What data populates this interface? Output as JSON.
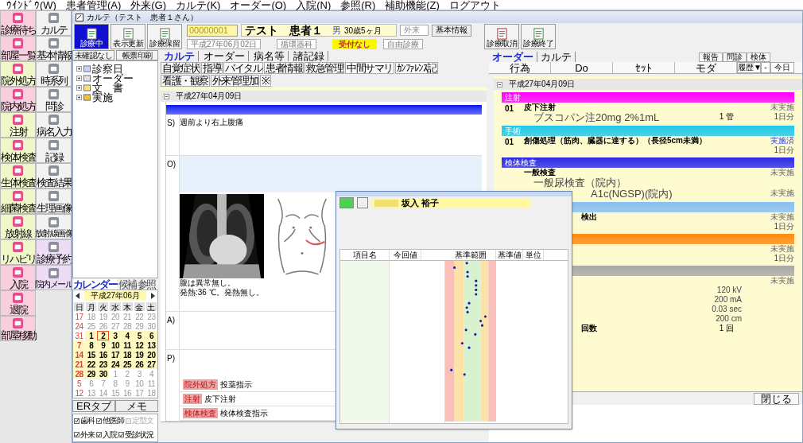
{
  "menu": [
    "ｳｲﾝﾄﾞｳ(W)",
    "患者管理(A)",
    "外来(G)",
    "カルテ(K)",
    "オーダー(O)",
    "入院(N)",
    "参照(R)",
    "補助機能(Z)",
    "ログアウト"
  ],
  "launcher": {
    "left": [
      {
        "label": "診療待ち",
        "color": "#f9cfe0"
      },
      {
        "label": "部屋一覧",
        "color": "#f9cfe0"
      },
      {
        "label": "院外処方",
        "color": "#eef7c8"
      },
      {
        "label": "院内処方",
        "color": "#f9cfe0"
      },
      {
        "label": "注射",
        "color": "#eef7c8"
      },
      {
        "label": "検体検査",
        "color": "#eef7c8"
      },
      {
        "label": "生体検査",
        "color": "#eef7c8"
      },
      {
        "label": "細菌検査",
        "color": "#eef7c8"
      },
      {
        "label": "放射線",
        "color": "#eef7c8"
      },
      {
        "label": "リハビリ",
        "color": "#eef7c8"
      },
      {
        "label": "入院",
        "color": "#f9cfe0"
      },
      {
        "label": "退院",
        "color": "#f9cfe0"
      },
      {
        "label": "部屋移動",
        "color": "#f9cfe0"
      }
    ],
    "right": [
      {
        "label": "カルテ",
        "color": "#f2f2f2"
      },
      {
        "label": "基本情報",
        "color": "#f2f2f2"
      },
      {
        "label": "時系列",
        "color": "#f2f2f2"
      },
      {
        "label": "問診",
        "color": "#f2f2f2"
      },
      {
        "label": "病名入力",
        "color": "#f2f2f2"
      },
      {
        "label": "記録",
        "color": "#f2f2f2"
      },
      {
        "label": "検査結果",
        "color": "#f2f2f2"
      },
      {
        "label": "生理画像",
        "color": "#f2f2f2"
      },
      {
        "label": "放射線画像",
        "color": "#f2f2f2"
      },
      {
        "label": "診療予約",
        "color": "#ecdcf5"
      },
      {
        "label": "院内メール",
        "color": "#ecdcf5"
      }
    ]
  },
  "window": {
    "title": "カルテ（テスト　患者１さん）"
  },
  "toolbar": {
    "left_buttons": [
      {
        "label": "診療中",
        "selected": true
      },
      {
        "label": "表示更新",
        "selected": false
      },
      {
        "label": "診療保留",
        "selected": false
      }
    ],
    "patient_id": "00000001",
    "patient_name": "テスト　患者１",
    "sex": "男",
    "age": "30歳5ヶ月",
    "visit_type": "外来",
    "info_button": "基本情報",
    "date": "平成27年06月02日",
    "department": "循環器科",
    "reception": "受付なし",
    "insurance": "自由診療",
    "right_buttons": [
      "診療取消",
      "診療終了"
    ]
  },
  "left_pane": {
    "buttons": [
      "未確認なし",
      "帳票印刷"
    ],
    "tree": [
      "診察日",
      "オーダー",
      "文　書",
      "実施"
    ],
    "tabs": [
      {
        "label": "カレンダー",
        "selected": true
      },
      {
        "label": "候補",
        "selected": false
      },
      {
        "label": "参照",
        "selected": false
      }
    ],
    "calendar": {
      "month": "平成27年06月",
      "weekdays": [
        "日",
        "月",
        "火",
        "水",
        "木",
        "金",
        "土"
      ],
      "weeks": [
        [
          {
            "day": "17",
            "in_month": false
          },
          {
            "day": "18",
            "in_month": false
          },
          {
            "day": "19",
            "in_month": false
          },
          {
            "day": "20",
            "in_month": false
          },
          {
            "day": "21",
            "in_month": false
          },
          {
            "day": "22",
            "in_month": false
          },
          {
            "day": "23",
            "in_month": false
          }
        ],
        [
          {
            "day": "24",
            "in_month": false
          },
          {
            "day": "25",
            "in_month": false
          },
          {
            "day": "26",
            "in_month": false
          },
          {
            "day": "27",
            "in_month": false
          },
          {
            "day": "28",
            "in_month": false
          },
          {
            "day": "29",
            "in_month": false
          },
          {
            "day": "30",
            "in_month": false
          }
        ],
        [
          {
            "day": "31",
            "in_month": false
          },
          {
            "day": "1",
            "in_month": true
          },
          {
            "day": "2",
            "in_month": true,
            "selected": true
          },
          {
            "day": "3",
            "in_month": true
          },
          {
            "day": "4",
            "in_month": true
          },
          {
            "day": "5",
            "in_month": true
          },
          {
            "day": "6",
            "in_month": true
          }
        ],
        [
          {
            "day": "7",
            "in_month": true
          },
          {
            "day": "8",
            "in_month": true
          },
          {
            "day": "9",
            "in_month": true
          },
          {
            "day": "10",
            "in_month": true
          },
          {
            "day": "11",
            "in_month": true
          },
          {
            "day": "12",
            "in_month": true
          },
          {
            "day": "13",
            "in_month": true
          }
        ],
        [
          {
            "day": "14",
            "in_month": true
          },
          {
            "day": "15",
            "in_month": true
          },
          {
            "day": "16",
            "in_month": true
          },
          {
            "day": "17",
            "in_month": true
          },
          {
            "day": "18",
            "in_month": true
          },
          {
            "day": "19",
            "in_month": true
          },
          {
            "day": "20",
            "in_month": true
          }
        ],
        [
          {
            "day": "21",
            "in_month": true
          },
          {
            "day": "22",
            "in_month": true
          },
          {
            "day": "23",
            "in_month": true
          },
          {
            "day": "24",
            "in_month": true
          },
          {
            "day": "25",
            "in_month": true
          },
          {
            "day": "26",
            "in_month": true
          },
          {
            "day": "27",
            "in_month": true
          }
        ],
        [
          {
            "day": "28",
            "in_month": true
          },
          {
            "day": "29",
            "in_month": true
          },
          {
            "day": "30",
            "in_month": true
          },
          {
            "day": "1",
            "in_month": false
          },
          {
            "day": "2",
            "in_month": false
          },
          {
            "day": "3",
            "in_month": false
          },
          {
            "day": "4",
            "in_month": false
          }
        ],
        [
          {
            "day": "5",
            "in_month": false
          },
          {
            "day": "6",
            "in_month": false
          },
          {
            "day": "7",
            "in_month": false
          },
          {
            "day": "8",
            "in_month": false
          },
          {
            "day": "9",
            "in_month": false
          },
          {
            "day": "10",
            "in_month": false
          },
          {
            "day": "11",
            "in_month": false
          }
        ],
        [
          {
            "day": "12",
            "in_month": false
          },
          {
            "day": "13",
            "in_month": false
          },
          {
            "day": "14",
            "in_month": false
          },
          {
            "day": "15",
            "in_month": false
          },
          {
            "day": "16",
            "in_month": false
          },
          {
            "day": "17",
            "in_month": false
          },
          {
            "day": "18",
            "in_month": false
          }
        ]
      ]
    },
    "bottom_tabs": [
      "ERタブ",
      "メモ"
    ],
    "filters": [
      {
        "label": "歯科",
        "checked": true,
        "disabled": false
      },
      {
        "label": "他医師",
        "checked": true,
        "disabled": false
      },
      {
        "label": "定型文",
        "checked": false,
        "disabled": true
      },
      {
        "label": "外来",
        "checked": true,
        "disabled": false
      },
      {
        "label": "入院",
        "checked": true,
        "disabled": false
      },
      {
        "label": "受診状況",
        "checked": true,
        "disabled": false
      }
    ]
  },
  "chart": {
    "tabs": [
      {
        "label": "カルテ",
        "selected": true
      },
      {
        "label": "オーダー",
        "selected": false
      },
      {
        "label": "病名等",
        "selected": false
      },
      {
        "label": "諸記録",
        "selected": false
      }
    ],
    "subtabs": [
      "自覚症状",
      "指導",
      "バイタル",
      "患者情報",
      "救急管理",
      "中間サマリ",
      "ｶﾝﾌｧﾚﾝｽ記",
      "看護・観察",
      "外来管理加",
      "※"
    ],
    "date": "平成27年04月09日",
    "s_label": "S)",
    "s_text": "週前より右上腹痛",
    "o_label": "O)",
    "o_lines": [
      "腹は異常無し。",
      "発熱:36 ℃。発熱無し。"
    ],
    "a_label": "A)",
    "p_label": "P)",
    "orders": [
      {
        "tag": "院外処方",
        "text": "投薬指示"
      },
      {
        "tag": "注射",
        "text": "皮下注射"
      },
      {
        "tag": "検体検査",
        "text": "検体検査指示"
      }
    ]
  },
  "orders_pane": {
    "tabs": [
      {
        "label": "オーダー",
        "selected": true
      },
      {
        "label": "カルテ",
        "selected": false
      }
    ],
    "buttons": [
      "報告",
      "問診",
      "検体"
    ],
    "columns": [
      "行為",
      "Do",
      "ｾｯﾄ",
      "モダ"
    ],
    "controls": [
      "履歴▼",
      "-",
      "今日"
    ],
    "date": "平成27年04月09日",
    "sections": [
      {
        "title": "注射",
        "color": "#ff00ff",
        "items": [
          {
            "kind": "full",
            "no": "01",
            "name": "皮下注射",
            "detail": "ブスコパン注20mg  2%1mL",
            "qty": "1 管",
            "status": "未実施",
            "done": false,
            "days": "1日分"
          }
        ]
      },
      {
        "title": "手術",
        "color": "#1ec8e8",
        "items": [
          {
            "kind": "full",
            "no": "01",
            "name": "創傷処理（筋肉、臓器に達する）（長径5cm未満）",
            "status": "実施済",
            "done": true,
            "days": "1日分"
          }
        ]
      },
      {
        "title": "検体検査",
        "color": "#2a2ae8",
        "items": [
          {
            "kind": "full",
            "name": "一般検査",
            "detail": "一般尿検査（院内）",
            "status": "未実施",
            "done": false
          },
          {
            "kind": "partial",
            "detail": "A1c(NGSP)(院内)",
            "status": "未実施",
            "done": false
          }
        ]
      },
      {
        "color": "#86bff2",
        "items": [
          {
            "kind": "partial",
            "name": "検出",
            "status": "未実施",
            "done": false,
            "days": "1日分"
          }
        ]
      },
      {
        "color": "#ff8c10",
        "items": [
          {
            "kind": "partial",
            "status": "未実施",
            "done": false,
            "days": "1日分"
          }
        ]
      },
      {
        "color": "#a8a8a8",
        "items": [
          {
            "kind": "partial",
            "status": "未実施",
            "done": false,
            "params": [
              "120 kV",
              "200 mA",
              "0.03 sec",
              "200 cm"
            ]
          },
          {
            "kind": "partial",
            "name": "回数",
            "qty": "1 回"
          }
        ]
      }
    ],
    "close_button": "閉じる"
  },
  "lab_window": {
    "patient_name": "坂入 裕子",
    "columns": [
      "項目名",
      "今回値",
      "基準範囲",
      "基準値",
      "単位"
    ]
  }
}
